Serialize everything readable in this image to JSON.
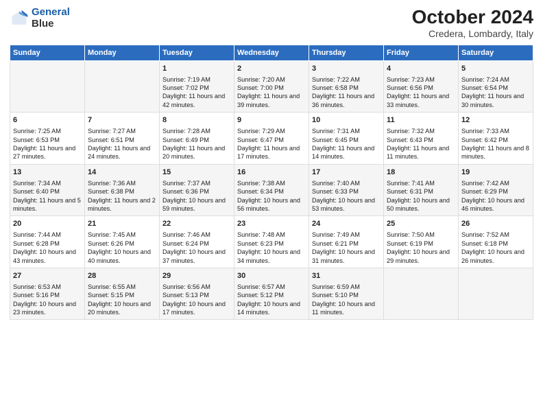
{
  "logo": {
    "line1": "General",
    "line2": "Blue"
  },
  "title": "October 2024",
  "subtitle": "Credera, Lombardy, Italy",
  "days": [
    "Sunday",
    "Monday",
    "Tuesday",
    "Wednesday",
    "Thursday",
    "Friday",
    "Saturday"
  ],
  "weeks": [
    [
      {
        "date": "",
        "sunrise": "",
        "sunset": "",
        "daylight": ""
      },
      {
        "date": "",
        "sunrise": "",
        "sunset": "",
        "daylight": ""
      },
      {
        "date": "1",
        "sunrise": "Sunrise: 7:19 AM",
        "sunset": "Sunset: 7:02 PM",
        "daylight": "Daylight: 11 hours and 42 minutes."
      },
      {
        "date": "2",
        "sunrise": "Sunrise: 7:20 AM",
        "sunset": "Sunset: 7:00 PM",
        "daylight": "Daylight: 11 hours and 39 minutes."
      },
      {
        "date": "3",
        "sunrise": "Sunrise: 7:22 AM",
        "sunset": "Sunset: 6:58 PM",
        "daylight": "Daylight: 11 hours and 36 minutes."
      },
      {
        "date": "4",
        "sunrise": "Sunrise: 7:23 AM",
        "sunset": "Sunset: 6:56 PM",
        "daylight": "Daylight: 11 hours and 33 minutes."
      },
      {
        "date": "5",
        "sunrise": "Sunrise: 7:24 AM",
        "sunset": "Sunset: 6:54 PM",
        "daylight": "Daylight: 11 hours and 30 minutes."
      }
    ],
    [
      {
        "date": "6",
        "sunrise": "Sunrise: 7:25 AM",
        "sunset": "Sunset: 6:53 PM",
        "daylight": "Daylight: 11 hours and 27 minutes."
      },
      {
        "date": "7",
        "sunrise": "Sunrise: 7:27 AM",
        "sunset": "Sunset: 6:51 PM",
        "daylight": "Daylight: 11 hours and 24 minutes."
      },
      {
        "date": "8",
        "sunrise": "Sunrise: 7:28 AM",
        "sunset": "Sunset: 6:49 PM",
        "daylight": "Daylight: 11 hours and 20 minutes."
      },
      {
        "date": "9",
        "sunrise": "Sunrise: 7:29 AM",
        "sunset": "Sunset: 6:47 PM",
        "daylight": "Daylight: 11 hours and 17 minutes."
      },
      {
        "date": "10",
        "sunrise": "Sunrise: 7:31 AM",
        "sunset": "Sunset: 6:45 PM",
        "daylight": "Daylight: 11 hours and 14 minutes."
      },
      {
        "date": "11",
        "sunrise": "Sunrise: 7:32 AM",
        "sunset": "Sunset: 6:43 PM",
        "daylight": "Daylight: 11 hours and 11 minutes."
      },
      {
        "date": "12",
        "sunrise": "Sunrise: 7:33 AM",
        "sunset": "Sunset: 6:42 PM",
        "daylight": "Daylight: 11 hours and 8 minutes."
      }
    ],
    [
      {
        "date": "13",
        "sunrise": "Sunrise: 7:34 AM",
        "sunset": "Sunset: 6:40 PM",
        "daylight": "Daylight: 11 hours and 5 minutes."
      },
      {
        "date": "14",
        "sunrise": "Sunrise: 7:36 AM",
        "sunset": "Sunset: 6:38 PM",
        "daylight": "Daylight: 11 hours and 2 minutes."
      },
      {
        "date": "15",
        "sunrise": "Sunrise: 7:37 AM",
        "sunset": "Sunset: 6:36 PM",
        "daylight": "Daylight: 10 hours and 59 minutes."
      },
      {
        "date": "16",
        "sunrise": "Sunrise: 7:38 AM",
        "sunset": "Sunset: 6:34 PM",
        "daylight": "Daylight: 10 hours and 56 minutes."
      },
      {
        "date": "17",
        "sunrise": "Sunrise: 7:40 AM",
        "sunset": "Sunset: 6:33 PM",
        "daylight": "Daylight: 10 hours and 53 minutes."
      },
      {
        "date": "18",
        "sunrise": "Sunrise: 7:41 AM",
        "sunset": "Sunset: 6:31 PM",
        "daylight": "Daylight: 10 hours and 50 minutes."
      },
      {
        "date": "19",
        "sunrise": "Sunrise: 7:42 AM",
        "sunset": "Sunset: 6:29 PM",
        "daylight": "Daylight: 10 hours and 46 minutes."
      }
    ],
    [
      {
        "date": "20",
        "sunrise": "Sunrise: 7:44 AM",
        "sunset": "Sunset: 6:28 PM",
        "daylight": "Daylight: 10 hours and 43 minutes."
      },
      {
        "date": "21",
        "sunrise": "Sunrise: 7:45 AM",
        "sunset": "Sunset: 6:26 PM",
        "daylight": "Daylight: 10 hours and 40 minutes."
      },
      {
        "date": "22",
        "sunrise": "Sunrise: 7:46 AM",
        "sunset": "Sunset: 6:24 PM",
        "daylight": "Daylight: 10 hours and 37 minutes."
      },
      {
        "date": "23",
        "sunrise": "Sunrise: 7:48 AM",
        "sunset": "Sunset: 6:23 PM",
        "daylight": "Daylight: 10 hours and 34 minutes."
      },
      {
        "date": "24",
        "sunrise": "Sunrise: 7:49 AM",
        "sunset": "Sunset: 6:21 PM",
        "daylight": "Daylight: 10 hours and 31 minutes."
      },
      {
        "date": "25",
        "sunrise": "Sunrise: 7:50 AM",
        "sunset": "Sunset: 6:19 PM",
        "daylight": "Daylight: 10 hours and 29 minutes."
      },
      {
        "date": "26",
        "sunrise": "Sunrise: 7:52 AM",
        "sunset": "Sunset: 6:18 PM",
        "daylight": "Daylight: 10 hours and 26 minutes."
      }
    ],
    [
      {
        "date": "27",
        "sunrise": "Sunrise: 6:53 AM",
        "sunset": "Sunset: 5:16 PM",
        "daylight": "Daylight: 10 hours and 23 minutes."
      },
      {
        "date": "28",
        "sunrise": "Sunrise: 6:55 AM",
        "sunset": "Sunset: 5:15 PM",
        "daylight": "Daylight: 10 hours and 20 minutes."
      },
      {
        "date": "29",
        "sunrise": "Sunrise: 6:56 AM",
        "sunset": "Sunset: 5:13 PM",
        "daylight": "Daylight: 10 hours and 17 minutes."
      },
      {
        "date": "30",
        "sunrise": "Sunrise: 6:57 AM",
        "sunset": "Sunset: 5:12 PM",
        "daylight": "Daylight: 10 hours and 14 minutes."
      },
      {
        "date": "31",
        "sunrise": "Sunrise: 6:59 AM",
        "sunset": "Sunset: 5:10 PM",
        "daylight": "Daylight: 10 hours and 11 minutes."
      },
      {
        "date": "",
        "sunrise": "",
        "sunset": "",
        "daylight": ""
      },
      {
        "date": "",
        "sunrise": "",
        "sunset": "",
        "daylight": ""
      }
    ]
  ]
}
